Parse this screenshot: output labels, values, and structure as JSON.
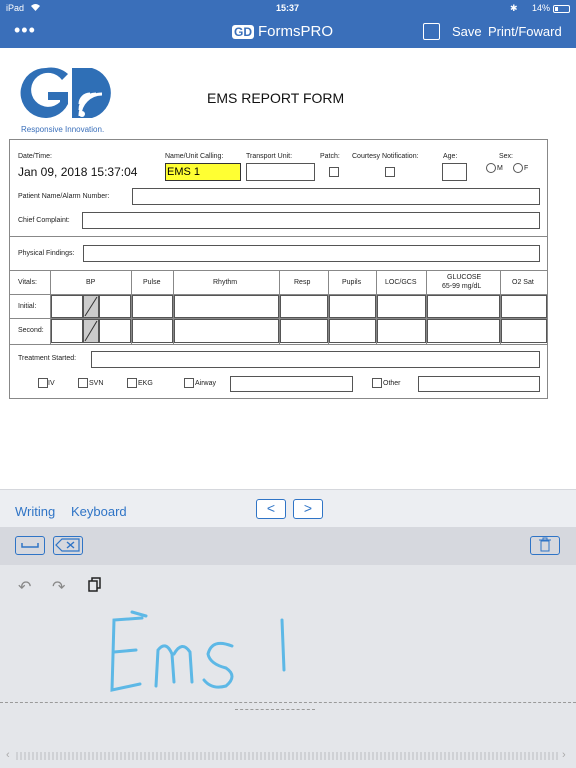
{
  "status": {
    "device": "iPad",
    "time": "15:37",
    "battery": "14%"
  },
  "nav": {
    "menu_label": "•••",
    "app_name": "FormsPRO",
    "logo_text": "GD",
    "save_label": "Save",
    "print_label": "Print/Foward"
  },
  "header": {
    "tagline": "Responsive Innovation.",
    "form_title": "EMS REPORT FORM"
  },
  "form": {
    "datetime_label": "Date/Time:",
    "datetime_value": "Jan 09, 2018 15:37:04",
    "unit_label": "Name/Unit Calling:",
    "unit_value": "EMS 1",
    "transport_label": "Transport Unit:",
    "patch_label": "Patch:",
    "courtesy_label": "Courtesy Notification:",
    "age_label": "Age:",
    "sex_label": "Sex:",
    "sex_m": "M",
    "sex_f": "F",
    "patient_label": "Patient Name/Alarm Number:",
    "complaint_label": "Chief Complaint:",
    "findings_label": "Physical Findings:",
    "vitals": {
      "headers": [
        "Vitals:",
        "BP",
        "Pulse",
        "Rhythm",
        "Resp",
        "Pupils",
        "LOC/GCS",
        "GLUCOSE",
        "O2 Sat"
      ],
      "glucose_sub": "65-99 mg/dL",
      "rows": [
        "Initial:",
        "Second:"
      ]
    },
    "treatment_label": "Treatment Started:",
    "checks": [
      "IV",
      "SVN",
      "EKG",
      "Airway",
      "Other"
    ]
  },
  "keyboard": {
    "tab_writing": "Writing",
    "tab_keyboard": "Keyboard",
    "prev": "<",
    "next": ">",
    "handwriting": "EMS 1"
  }
}
